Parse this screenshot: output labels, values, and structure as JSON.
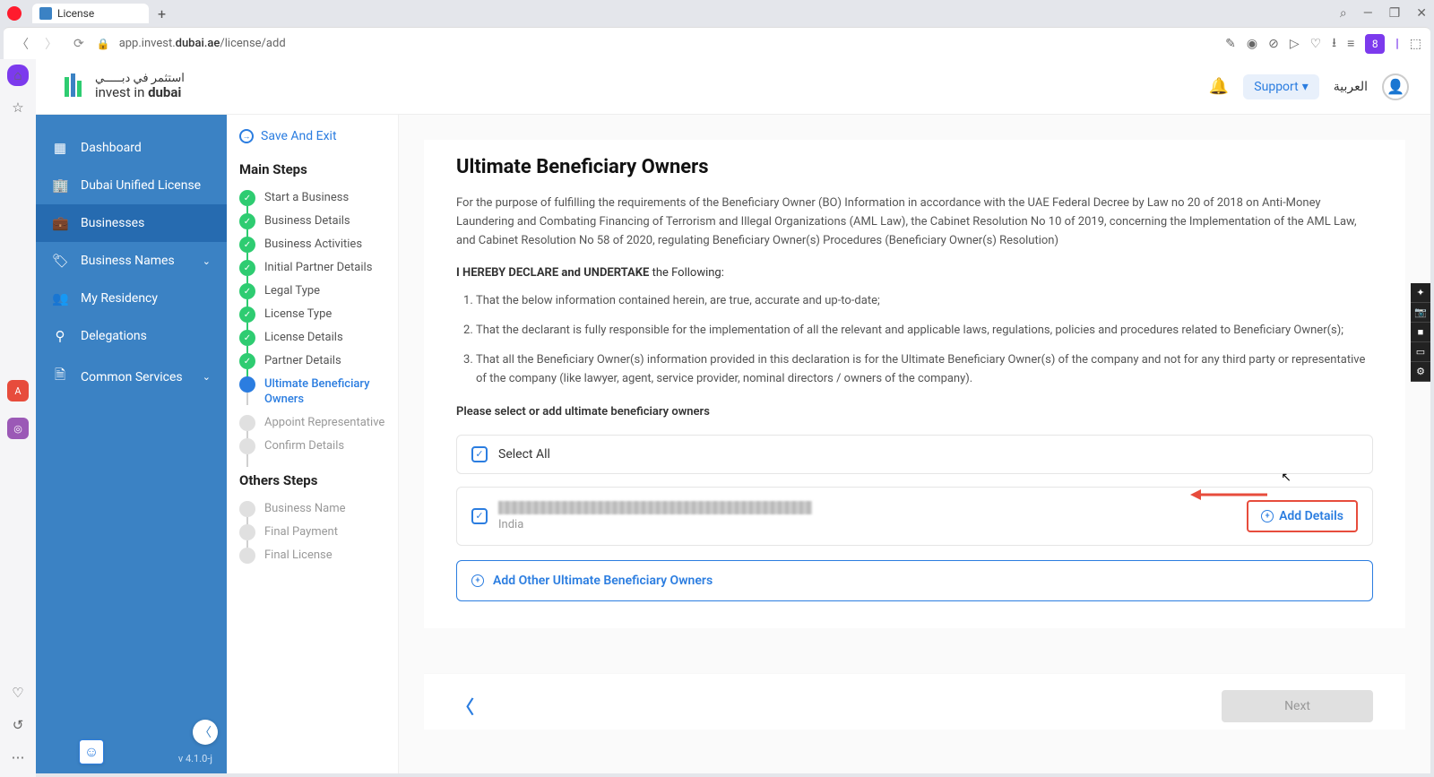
{
  "browser": {
    "tab_title": "License",
    "url_prefix": "app.invest.",
    "url_bold": "dubai.ae",
    "url_suffix": "/license/add"
  },
  "header": {
    "logo_ar": "استثمر في دبـــــي",
    "logo_en_pre": "invest in ",
    "logo_en_bold": "dubai",
    "support": "Support",
    "lang": "العربية"
  },
  "nav": {
    "dashboard": "Dashboard",
    "dul": "Dubai Unified License",
    "businesses": "Businesses",
    "names": "Business Names",
    "residency": "My Residency",
    "delegations": "Delegations",
    "common": "Common Services",
    "version": "v 4.1.0-j"
  },
  "steps": {
    "save_exit": "Save And Exit",
    "main_heading": "Main Steps",
    "list": [
      "Start a Business",
      "Business Details",
      "Business Activities",
      "Initial Partner Details",
      "Legal Type",
      "License Type",
      "License Details",
      "Partner Details",
      "Ultimate Beneficiary Owners",
      "Appoint Representative",
      "Confirm Details"
    ],
    "other_heading": "Others Steps",
    "other_list": [
      "Business Name",
      "Final Payment",
      "Final License"
    ]
  },
  "content": {
    "title": "Ultimate Beneficiary Owners",
    "intro": "For the purpose of fulfilling the requirements of the Beneficiary Owner (BO) Information in accordance with the UAE Federal Decree by Law no 20 of 2018 on Anti-Money Laundering and Combating Financing of Terrorism and Illegal Organizations (AML Law), the Cabinet Resolution No 10 of 2019, concerning the Implementation of the AML Law, and Cabinet Resolution No 58 of 2020, regulating Beneficiary Owner(s) Procedures (Beneficiary Owner(s) Resolution)",
    "declare_bold": "I HEREBY DECLARE and UNDERTAKE",
    "declare_rest": " the Following:",
    "bullets": [
      "That the below information contained herein, are true, accurate and up-to-date;",
      "That the declarant is fully responsible for the implementation of all the relevant and applicable laws, regulations, policies and procedures related to Beneficiary Owner(s);",
      "That all the Beneficiary Owner(s) information provided in this declaration is for the Ultimate Beneficiary Owner(s) of the company and not for any third party or representative of the company (like lawyer, agent, service provider, nominal directors / owners of the company)."
    ],
    "select_prompt": "Please select or add ultimate beneficiary owners",
    "select_all": "Select All",
    "owner_country": "India",
    "add_details": "Add Details",
    "add_other": "Add Other Ultimate Beneficiary Owners",
    "next": "Next"
  }
}
